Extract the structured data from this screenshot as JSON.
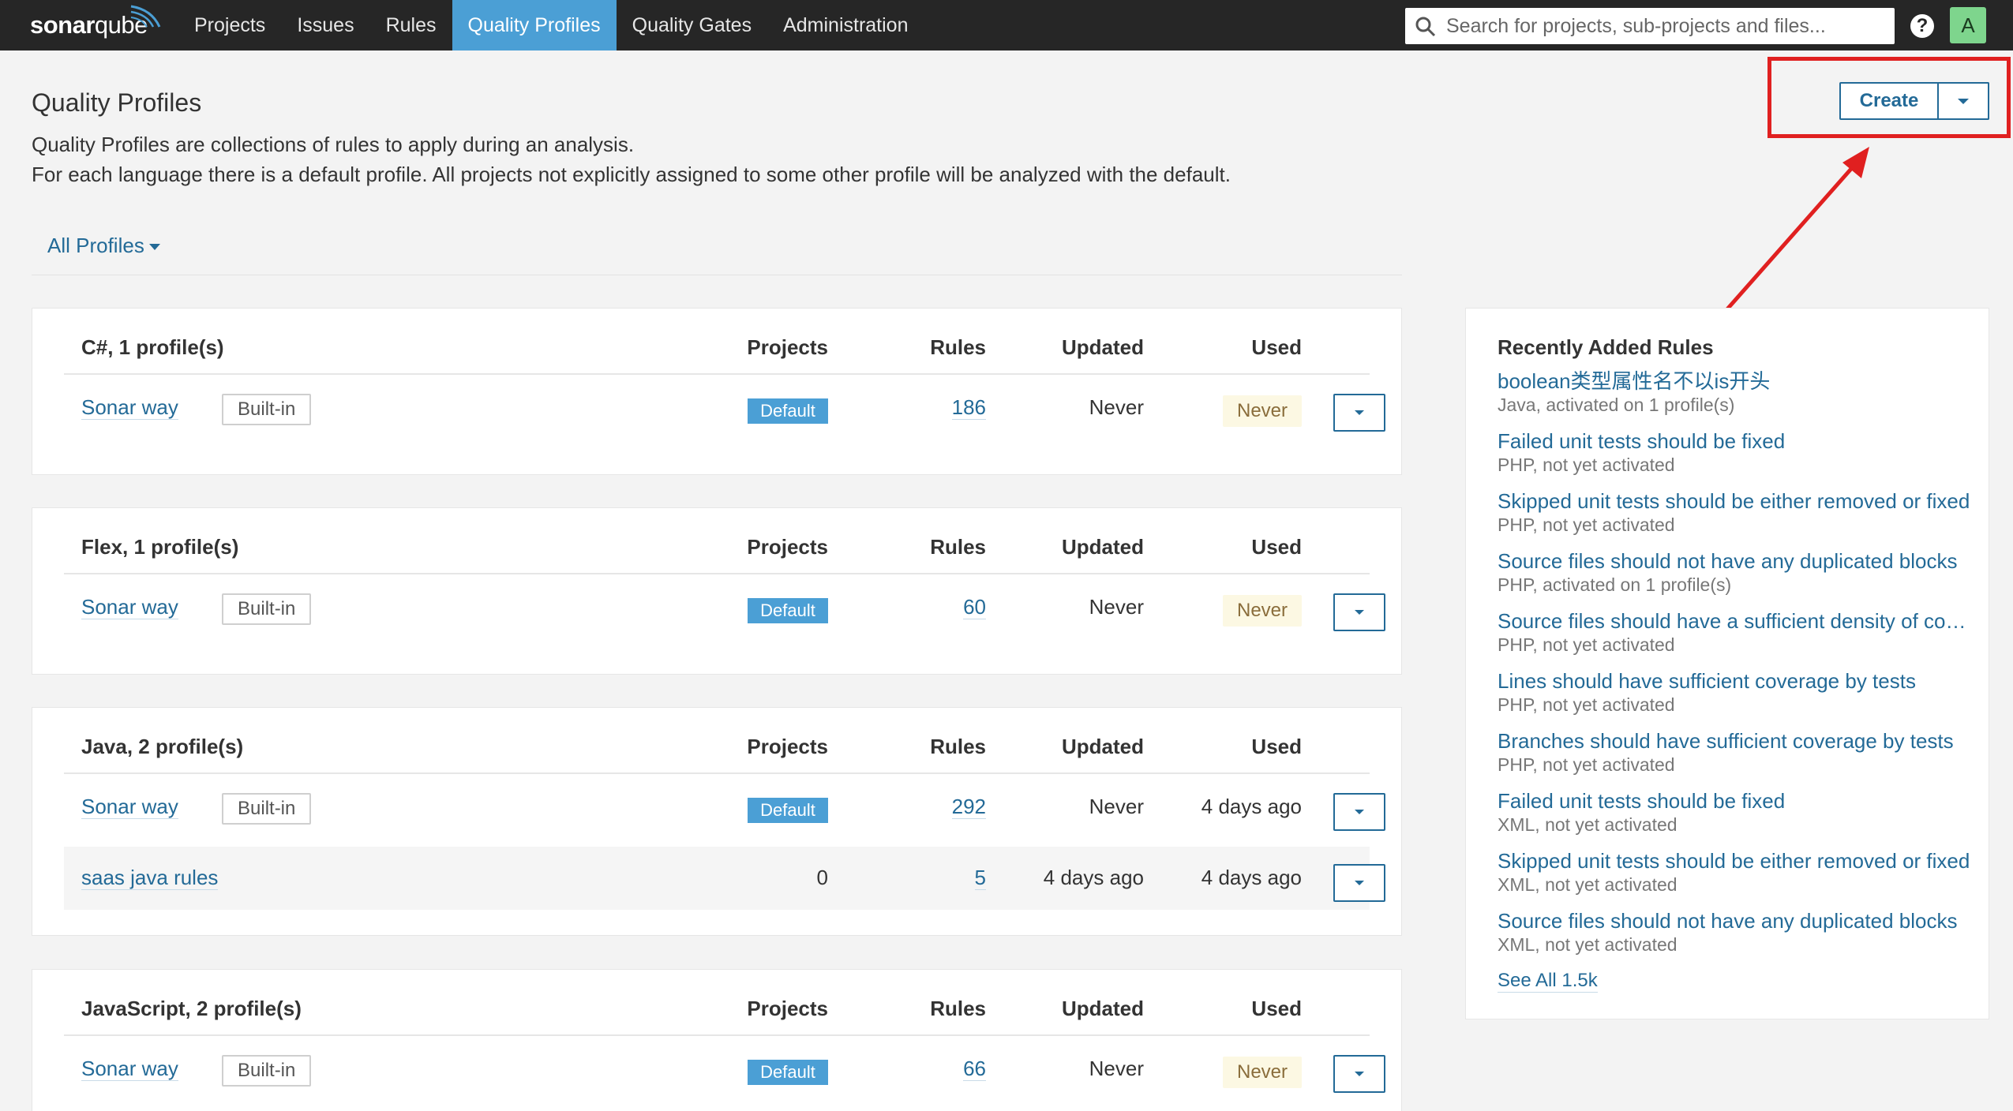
{
  "nav": {
    "logo_bold": "sonar",
    "logo_light": "qube",
    "items": [
      {
        "label": "Projects"
      },
      {
        "label": "Issues"
      },
      {
        "label": "Rules"
      },
      {
        "label": "Quality Profiles"
      },
      {
        "label": "Quality Gates"
      },
      {
        "label": "Administration"
      }
    ],
    "search_placeholder": "Search for projects, sub-projects and files...",
    "help": "?",
    "avatar": "A"
  },
  "page": {
    "title": "Quality Profiles",
    "desc1": "Quality Profiles are collections of rules to apply during an analysis.",
    "desc2": "For each language there is a default profile. All projects not explicitly assigned to some other profile will be analyzed with the default.",
    "filter": "All Profiles",
    "create": "Create"
  },
  "columns": {
    "projects": "Projects",
    "rules": "Rules",
    "updated": "Updated",
    "used": "Used"
  },
  "labels": {
    "builtin": "Built-in",
    "default": "Default",
    "never": "Never"
  },
  "languages": [
    {
      "name": "C#, 1 profile(s)",
      "profiles": [
        {
          "name": "Sonar way",
          "rules": "186",
          "updated": "Never",
          "used": "Never"
        }
      ]
    },
    {
      "name": "Flex, 1 profile(s)",
      "profiles": [
        {
          "name": "Sonar way",
          "rules": "60",
          "updated": "Never",
          "used": "Never"
        }
      ]
    },
    {
      "name": "Java, 2 profile(s)",
      "profiles": [
        {
          "name": "Sonar way",
          "rules": "292",
          "updated": "Never",
          "used": "4 days ago"
        },
        {
          "name": "saas java rules",
          "projects": "0",
          "rules": "5",
          "updated": "4 days ago",
          "used": "4 days ago"
        }
      ]
    },
    {
      "name": "JavaScript, 2 profile(s)",
      "profiles": [
        {
          "name": "Sonar way",
          "rules": "66",
          "updated": "Never",
          "used": "Never"
        }
      ]
    }
  ],
  "recent": {
    "title": "Recently Added Rules",
    "rules": [
      {
        "name": "boolean类型属性名不以is开头",
        "meta": "Java, activated on 1 profile(s)"
      },
      {
        "name": "Failed unit tests should be fixed",
        "meta": "PHP, not yet activated"
      },
      {
        "name": "Skipped unit tests should be either removed or fixed",
        "meta": "PHP, not yet activated"
      },
      {
        "name": "Source files should not have any duplicated blocks",
        "meta": "PHP, activated on 1 profile(s)"
      },
      {
        "name": "Source files should have a sufficient density of comment lines",
        "meta": "PHP, not yet activated"
      },
      {
        "name": "Lines should have sufficient coverage by tests",
        "meta": "PHP, not yet activated"
      },
      {
        "name": "Branches should have sufficient coverage by tests",
        "meta": "PHP, not yet activated"
      },
      {
        "name": "Failed unit tests should be fixed",
        "meta": "XML, not yet activated"
      },
      {
        "name": "Skipped unit tests should be either removed or fixed",
        "meta": "XML, not yet activated"
      },
      {
        "name": "Source files should not have any duplicated blocks",
        "meta": "XML, not yet activated"
      }
    ],
    "see_all": "See All 1.5k"
  },
  "colors": {
    "nav_bg": "#262626",
    "accent": "#4b9fd5",
    "link": "#236a97",
    "highlight": "#e02020"
  }
}
